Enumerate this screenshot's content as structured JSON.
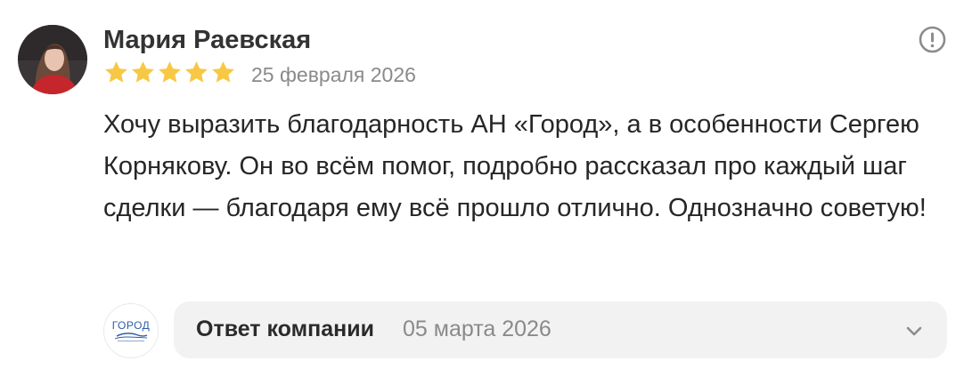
{
  "review": {
    "author_name": "Мария Раевская",
    "rating": 5,
    "rating_max": 5,
    "star_color": "#f7c844",
    "date": "25 февраля 2026",
    "text": "Хочу выразить благодарность АН «Город», а в особенности Сергею Корнякову. Он во всём помог, подробно рассказал про каждый шаг сделки — благодаря ему всё прошло отлично. Однозначно советую!"
  },
  "actions": {
    "more_icon": "exclamation-circle-icon"
  },
  "company_reply": {
    "logo_text": "ГОРОД",
    "label": "Ответ компании",
    "date": "05 марта 2026",
    "expand_icon": "chevron-down-icon"
  }
}
